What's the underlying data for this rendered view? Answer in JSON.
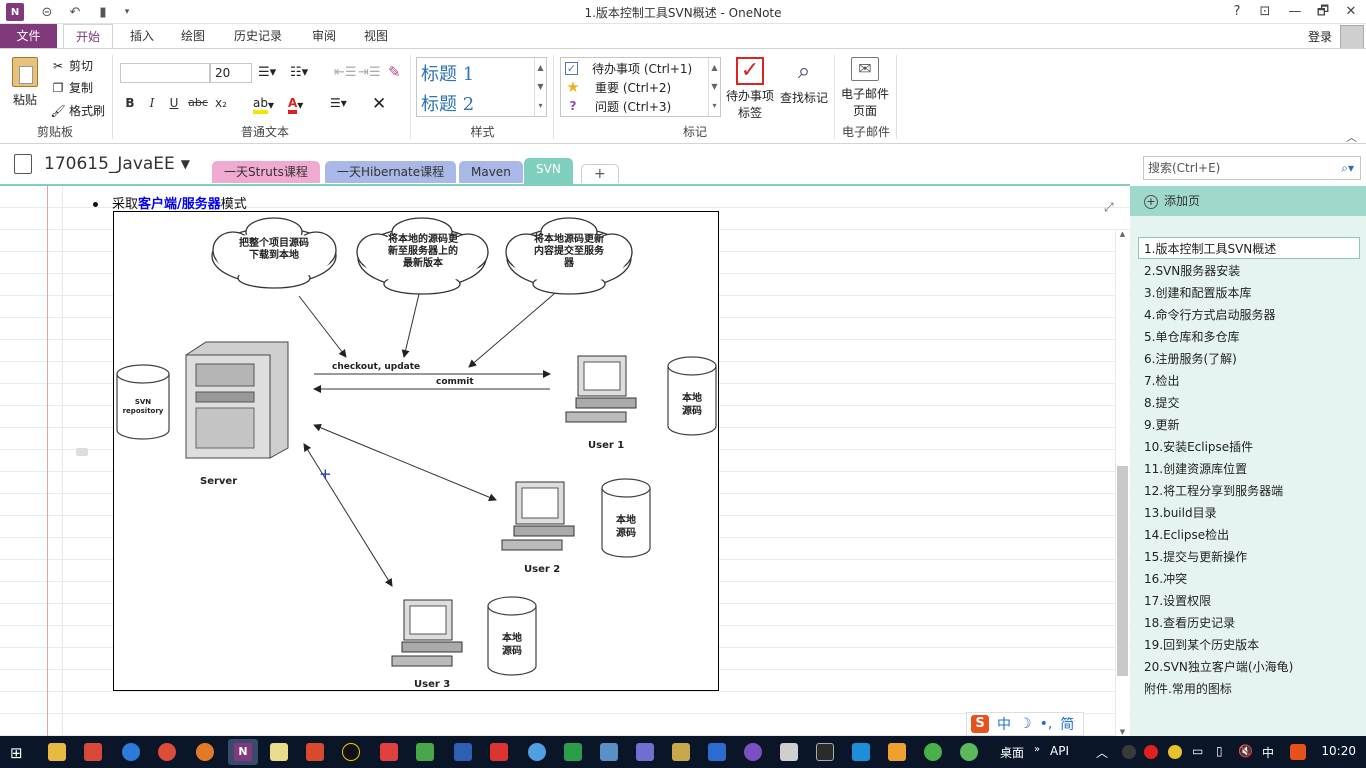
{
  "window": {
    "title": "1.版本控制工具SVN概述 - OneNote",
    "help": "?",
    "restore_ribbon": "⊡",
    "minimize": "—",
    "maximize": "🗗",
    "close": "✕"
  },
  "ribbon_tabs": [
    "文件",
    "开始",
    "插入",
    "绘图",
    "历史记录",
    "审阅",
    "视图"
  ],
  "account": {
    "login": "登录"
  },
  "clipboard": {
    "paste": "粘贴",
    "cut": "剪切",
    "copy": "复制",
    "format_painter": "格式刷",
    "label": "剪贴板"
  },
  "basic_text": {
    "font_name": "",
    "font_size": "20",
    "bold": "B",
    "italic": "I",
    "underline": "U",
    "strike": "abc",
    "subscript": "x₂",
    "label": "普通文本"
  },
  "styles": {
    "heading1": "标题 1",
    "heading2": "标题 2",
    "label": "样式"
  },
  "tags": {
    "items": [
      {
        "text": "待办事项 (Ctrl+1)",
        "icon": "checkbox-icon"
      },
      {
        "text": "重要 (Ctrl+2)",
        "icon": "star-icon"
      },
      {
        "text": "问题 (Ctrl+3)",
        "icon": "question-icon"
      }
    ],
    "todo_tag_l1": "待办事项",
    "todo_tag_l2": "标签",
    "find_tags": "查找标记",
    "label": "标记"
  },
  "email": {
    "btn_l1": "电子邮件",
    "btn_l2": "页面",
    "label": "电子邮件"
  },
  "notebook": {
    "name": "170615_JavaEE",
    "sections": [
      {
        "name": "一天Struts课程",
        "color": "#f0a9d0"
      },
      {
        "name": "一天Hibernate课程",
        "color": "#a9b8e6"
      },
      {
        "name": "Maven",
        "color": "#a9b8e6"
      },
      {
        "name": "SVN",
        "color": "#7fcfbf"
      }
    ],
    "add_section": "+"
  },
  "search": {
    "placeholder": "搜索(Ctrl+E)"
  },
  "content": {
    "bullet_prefix": "采取",
    "bullet_highlight": "客户端/服务器",
    "bullet_suffix": "模式",
    "diagram": {
      "cloud1": [
        "把整个项目源码",
        "下载到本地"
      ],
      "cloud2": [
        "将本地的源码更",
        "新至服务器上的",
        "最新版本"
      ],
      "cloud3": [
        "将本地源码更新",
        "内容提交至服务",
        "器"
      ],
      "checkout": "checkout, update",
      "commit": "commit",
      "repo": [
        "SVN",
        "repository"
      ],
      "server": "Server",
      "user1": "User 1",
      "user2": "User 2",
      "user3": "User 3",
      "local": [
        "本地",
        "源码"
      ]
    }
  },
  "pages": {
    "add": "添加页",
    "items": [
      "1.版本控制工具SVN概述",
      "2.SVN服务器安装",
      "3.创建和配置版本库",
      "4.命令行方式启动服务器",
      "5.单仓库和多仓库",
      "6.注册服务(了解)",
      "7.检出",
      "8.提交",
      "9.更新",
      "10.安装Eclipse插件",
      "11.创建资源库位置",
      "12.将工程分享到服务器端",
      "13.build目录",
      "14.Eclipse检出",
      "15.提交与更新操作",
      "16.冲突",
      "17.设置权限",
      "18.查看历史记录",
      "19.回到某个历史版本",
      "20.SVN独立客户端(小海龟)",
      "附件.常用的图标"
    ],
    "selected": 0
  },
  "ime": {
    "zh": "中",
    "simp": "简"
  },
  "taskbar": {
    "desktop": "桌面",
    "api": "API",
    "lang": "中",
    "time": "10:20"
  }
}
